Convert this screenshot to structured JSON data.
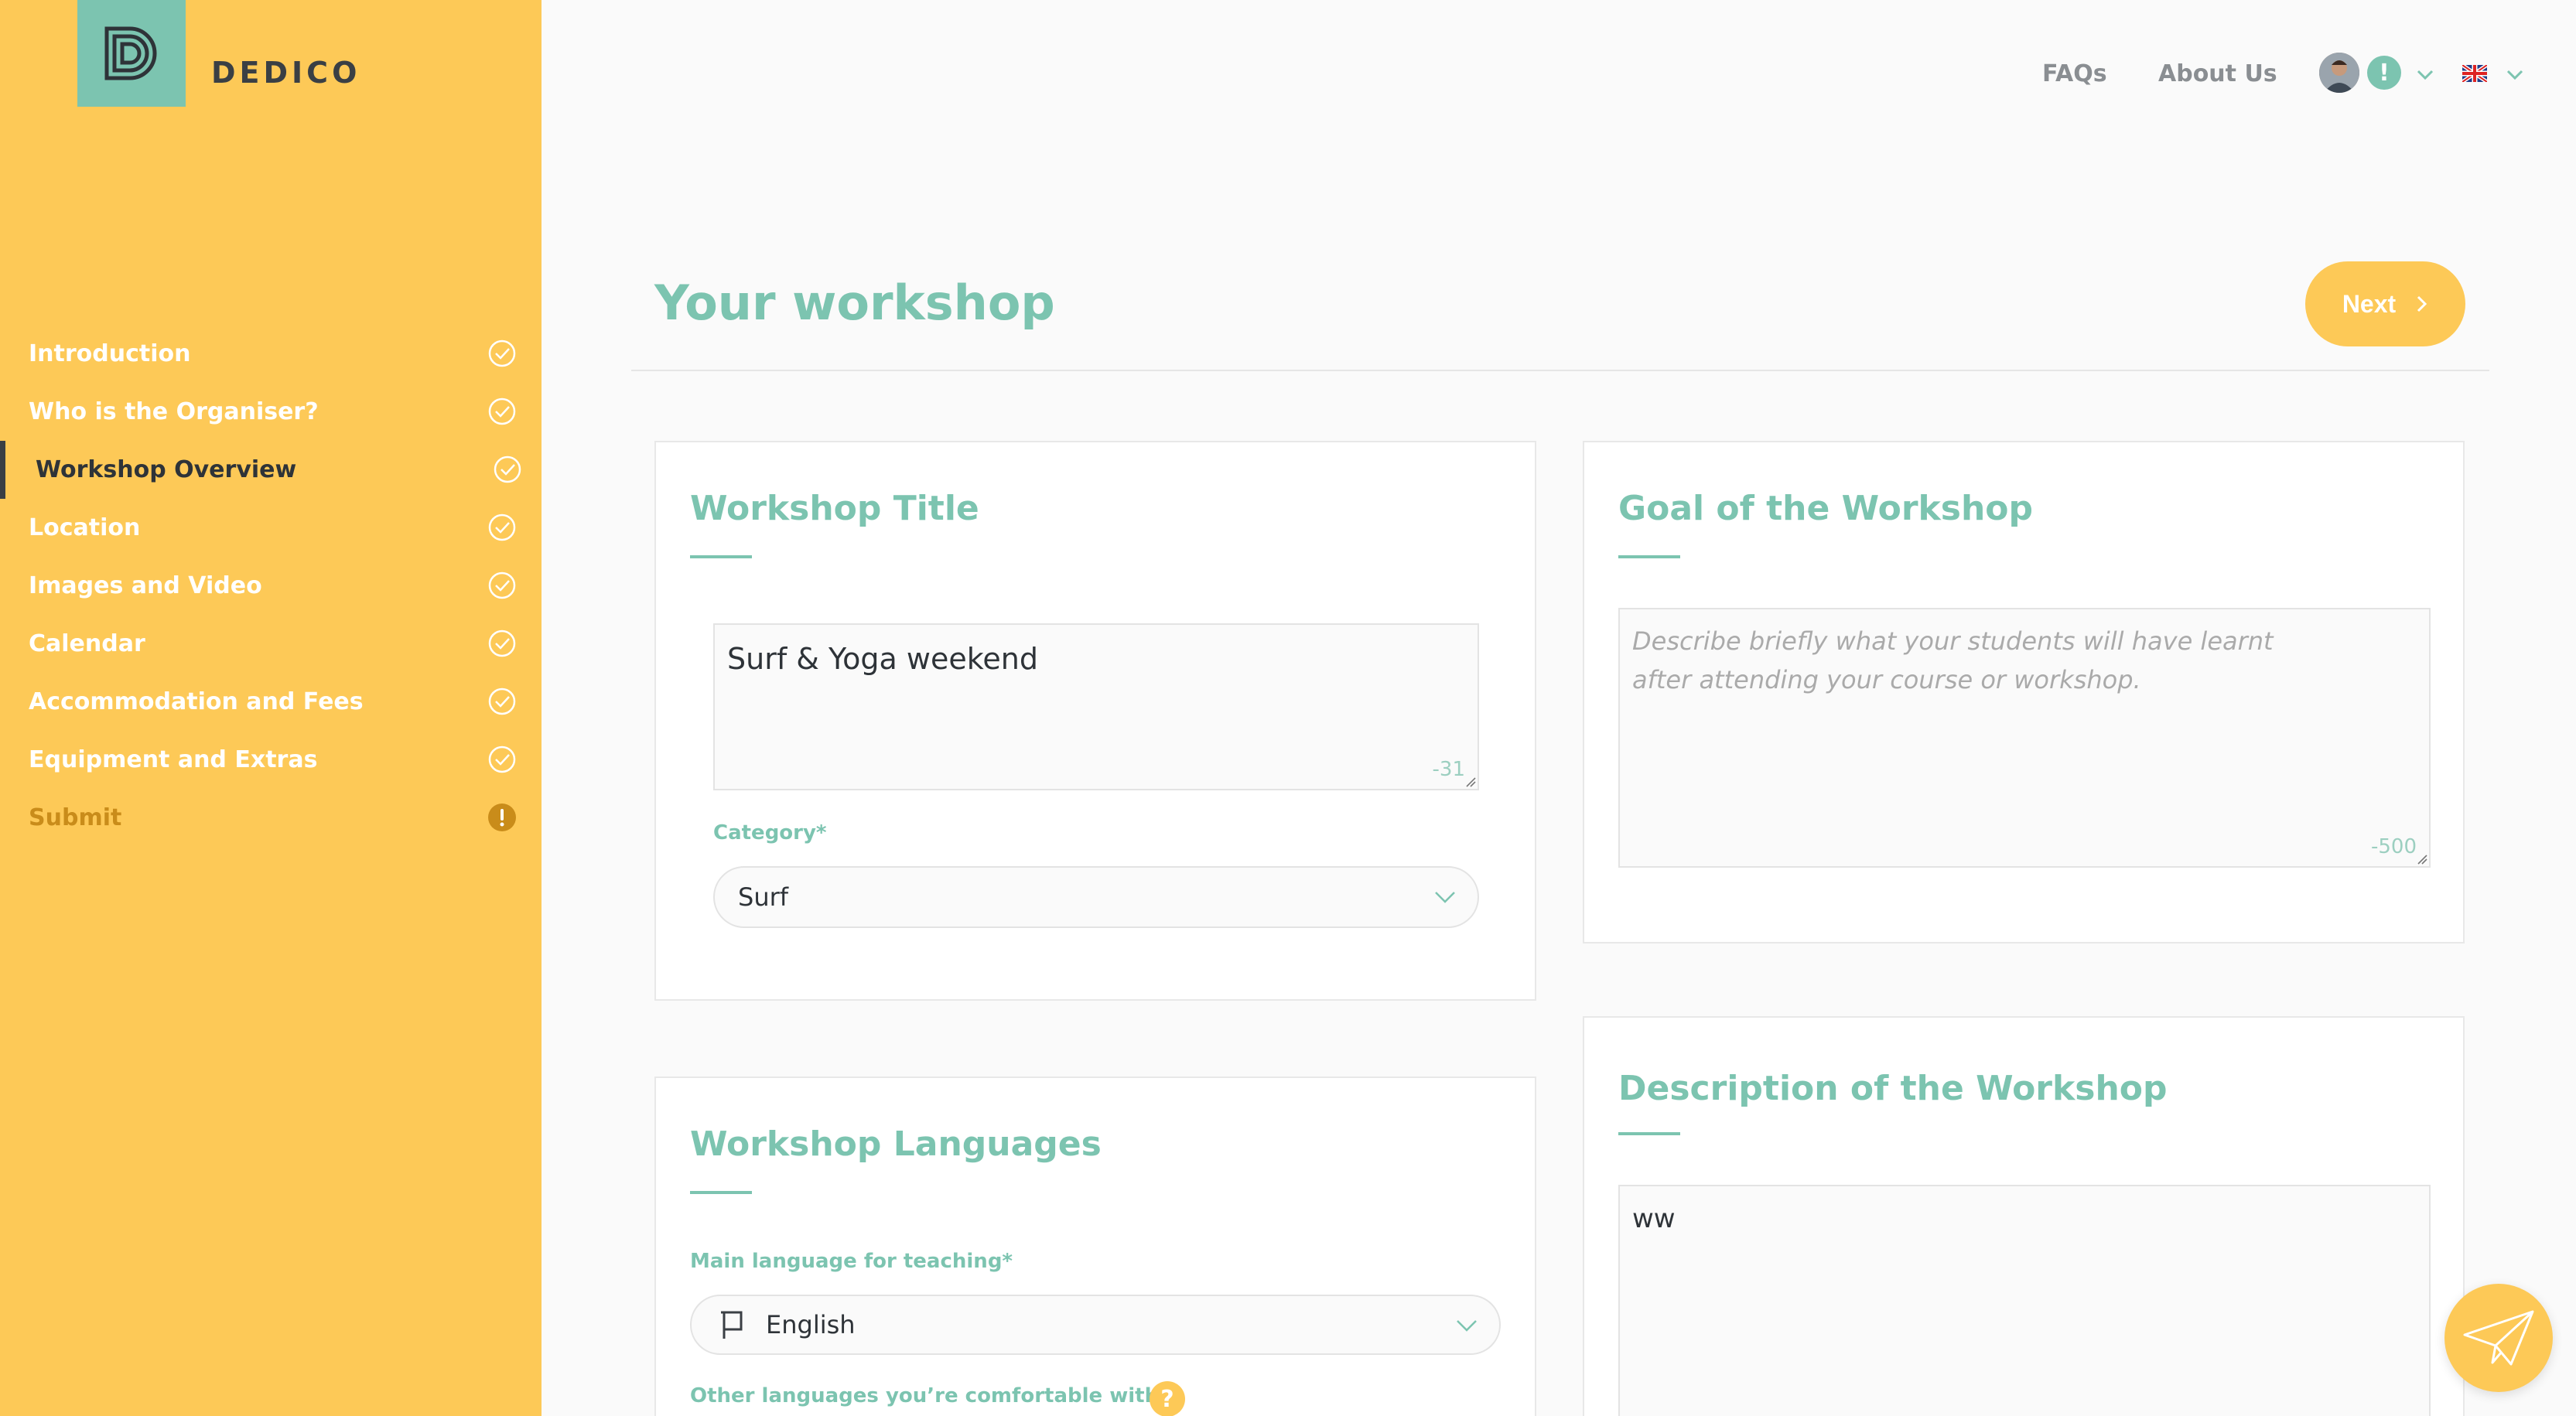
{
  "brand": {
    "name": "DEDICO"
  },
  "colors": {
    "accent": "#7cc4b0",
    "sidebar": "#fdc957",
    "warning": "#c98c1a"
  },
  "header": {
    "faqs": "FAQs",
    "about": "About Us",
    "notification_badge": "!"
  },
  "sidebar": {
    "items": [
      {
        "label": "Introduction",
        "status": "check-circle-icon"
      },
      {
        "label": "Who is the Organiser?",
        "status": "check-circle-icon"
      },
      {
        "label": "Workshop Overview",
        "status": "check-circle-icon",
        "active": true
      },
      {
        "label": "Location",
        "status": "check-circle-icon"
      },
      {
        "label": "Images and Video",
        "status": "check-circle-icon"
      },
      {
        "label": "Calendar",
        "status": "check-circle-icon"
      },
      {
        "label": "Accommodation and Fees",
        "status": "check-circle-icon"
      },
      {
        "label": "Equipment and Extras",
        "status": "check-circle-icon"
      },
      {
        "label": "Submit",
        "status": "warning-icon"
      }
    ]
  },
  "page": {
    "title": "Your workshop",
    "next_label": "Next"
  },
  "workshop_title_card": {
    "title": "Workshop Title",
    "value": "Surf & Yoga weekend",
    "counter": "-31",
    "category_label": "Category*",
    "category_value": "Surf"
  },
  "goal_card": {
    "title": "Goal of the Workshop",
    "placeholder": "Describe briefly what your students will have learnt after attending your course or workshop.",
    "counter": "-500"
  },
  "languages_card": {
    "title": "Workshop Languages",
    "main_label": "Main language for teaching*",
    "main_value": "English",
    "other_label": "Other languages you’re comfortable with",
    "help": "?"
  },
  "description_card": {
    "title": "Description of the Workshop",
    "value": "ww"
  }
}
